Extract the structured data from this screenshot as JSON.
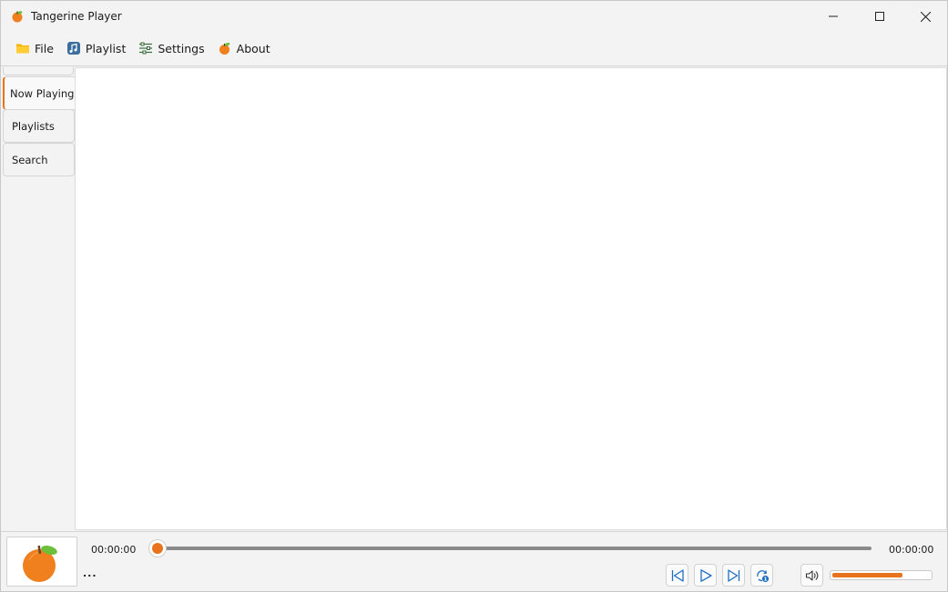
{
  "window": {
    "title": "Tangerine Player"
  },
  "menu": {
    "items": [
      {
        "label": "File",
        "icon": "folder-icon"
      },
      {
        "label": "Playlist",
        "icon": "music-note-icon"
      },
      {
        "label": "Settings",
        "icon": "sliders-icon"
      },
      {
        "label": "About",
        "icon": "tangerine-icon"
      }
    ]
  },
  "tabs": [
    {
      "label": "Now Playing",
      "active": true
    },
    {
      "label": "Playlists",
      "active": false
    },
    {
      "label": "Search",
      "active": false
    }
  ],
  "player": {
    "current_time": "00:00:00",
    "total_time": "00:00:00",
    "track_name": "...",
    "seek_fraction": 0.0,
    "volume_fraction": 0.72
  },
  "colors": {
    "accent": "#e8731c",
    "tangerine_body": "#f07f1d",
    "leaf": "#6cbf3a",
    "control_blue": "#1f6fc1"
  }
}
